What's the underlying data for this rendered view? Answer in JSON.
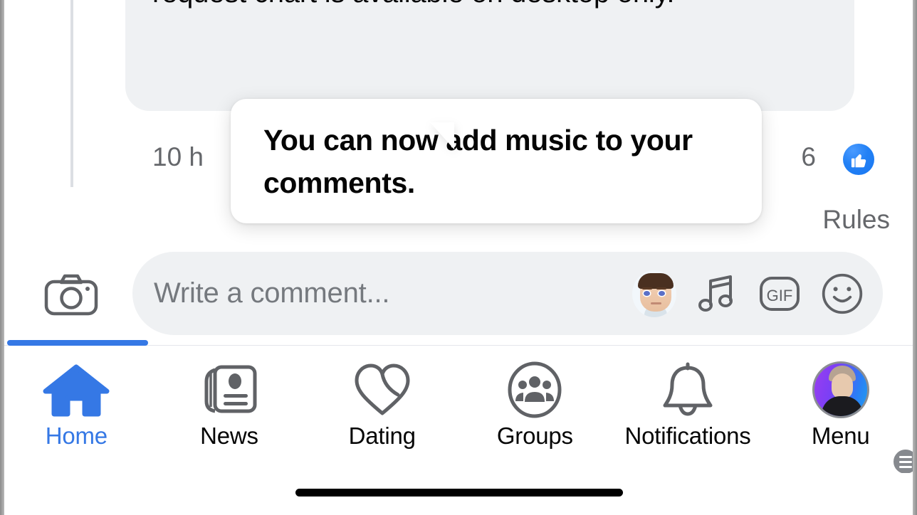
{
  "thread": {
    "comment_text": "Android, and desktop platforms. The membership request chart is available on desktop only.",
    "timestamp": "10 h",
    "like_count": "6",
    "like_icon": "thumbs-up-icon"
  },
  "composer": {
    "rules_label": "Rules",
    "camera_icon": "camera-icon",
    "placeholder": "Write a comment...",
    "input_value": "",
    "icons": [
      {
        "name": "avatar-memoji-icon",
        "label": "Avatar"
      },
      {
        "name": "music-note-icon",
        "label": "Music"
      },
      {
        "name": "gif-icon",
        "label": "GIF"
      },
      {
        "name": "sticker-smiley-icon",
        "label": "Sticker"
      }
    ]
  },
  "tooltip": {
    "text": "You can now add music to your comments."
  },
  "tabbar": {
    "active_index": 0,
    "tabs": [
      {
        "label": "Home",
        "icon": "home-icon"
      },
      {
        "label": "News",
        "icon": "newspaper-icon"
      },
      {
        "label": "Dating",
        "icon": "dating-heart-icon"
      },
      {
        "label": "Groups",
        "icon": "groups-icon"
      },
      {
        "label": "Notifications",
        "icon": "bell-icon"
      },
      {
        "label": "Menu",
        "icon": "profile-avatar-menu-icon"
      }
    ]
  },
  "colors": {
    "accent_blue": "#3578e5",
    "like_blue": "#1877f2",
    "bubble_gray": "#eff1f3",
    "text_secondary": "#65676b",
    "text_primary": "#050505"
  }
}
